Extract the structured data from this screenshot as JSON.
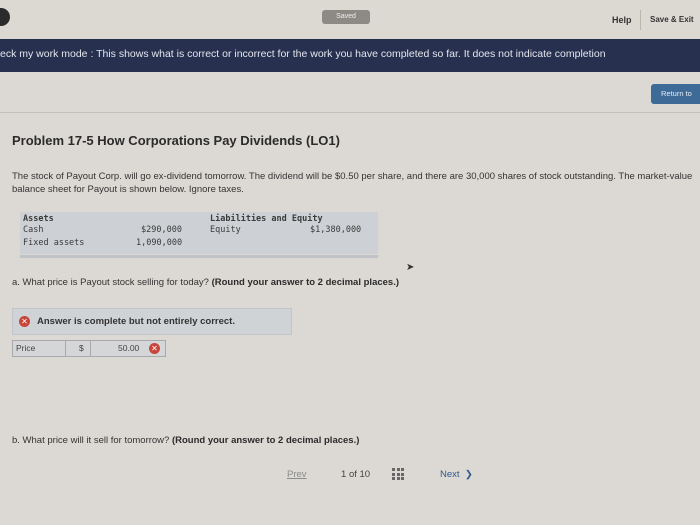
{
  "header": {
    "saved_badge": "Saved",
    "help": "Help",
    "save_exit": "Save & Exit"
  },
  "banner": {
    "text": "eck my work mode : This shows what is correct or incorrect for the work you have completed so far. It does not indicate completion"
  },
  "return_button": "Return to",
  "problem": {
    "title": "Problem 17-5 How Corporations Pay Dividends (LO1)",
    "text": "The stock of Payout Corp. will go ex-dividend tomorrow. The dividend will be $0.50 per share, and there are 30,000 shares of stock outstanding. The market-value balance sheet for Payout is shown below. Ignore taxes."
  },
  "balance_sheet": {
    "assets_header": "Assets",
    "liab_header": "Liabilities and Equity",
    "cash_label": "Cash",
    "cash_value": "$290,000",
    "fixed_label": "Fixed assets",
    "fixed_value": "1,090,000",
    "equity_label": "Equity",
    "equity_value": "$1,380,000"
  },
  "question_a": {
    "text": "a. What price is Payout stock selling for today? ",
    "bold": "(Round your answer to 2 decimal places.)"
  },
  "answer_status": "Answer is complete but not entirely correct.",
  "price_row": {
    "label": "Price",
    "currency": "$",
    "value": "50.00"
  },
  "question_b": {
    "text": "b. What price will it sell for tomorrow? ",
    "bold": "(Round your answer to 2 decimal places.)"
  },
  "pager": {
    "prev": "Prev",
    "page": "1",
    "of": "of",
    "total": "10",
    "next": "Next"
  },
  "icons": {
    "incorrect": "x-circle-icon",
    "grid": "grid-icon",
    "next": "chevron-right-icon",
    "cursor": "mouse-pointer-icon"
  },
  "colors": {
    "banner_bg": "#27314f",
    "error_red": "#c8453c",
    "return_btn": "#3d6a96"
  }
}
